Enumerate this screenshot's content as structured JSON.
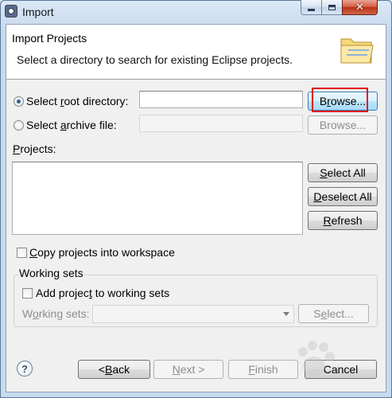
{
  "window": {
    "title": "Import",
    "close_glyph": "✕"
  },
  "banner": {
    "title": "Import Projects",
    "description": "Select a directory to search for existing Eclipse projects."
  },
  "source": {
    "root_directory": {
      "label_pre": "Select ",
      "label_u": "r",
      "label_post": "oot directory:",
      "selected": true,
      "value": "",
      "browse_pre": "B",
      "browse_u": "r",
      "browse_post": "owse..."
    },
    "archive_file": {
      "label_pre": "Select ",
      "label_u": "a",
      "label_post": "rchive file:",
      "selected": false,
      "value": "",
      "browse_label": "Browse..."
    }
  },
  "projects": {
    "label_u": "P",
    "label_post": "rojects:",
    "items": [],
    "select_all": {
      "u": "S",
      "rest": "elect All"
    },
    "deselect_all": {
      "u": "D",
      "rest": "eselect All"
    },
    "refresh": {
      "u": "R",
      "rest": "efresh"
    }
  },
  "options": {
    "copy_pre": "",
    "copy_u": "C",
    "copy_post": "opy projects into workspace",
    "copy_checked": false
  },
  "working_sets": {
    "legend": "Working sets",
    "add_pre": "Add projec",
    "add_u": "t",
    "add_post": " to working sets",
    "add_checked": false,
    "sets_pre": "W",
    "sets_u": "o",
    "sets_post": "rking sets:",
    "selected_value": "",
    "select_label_pre": "S",
    "select_label_u": "e",
    "select_label_post": "lect..."
  },
  "footer": {
    "help_glyph": "?",
    "back_pre": "< ",
    "back_u": "B",
    "back_post": "ack",
    "next_u": "N",
    "next_post": "ext >",
    "finish_u": "F",
    "finish_post": "inish",
    "cancel": "Cancel"
  },
  "colors": {
    "highlight_box": "#e0131b",
    "focus_button": "#3c7fb1"
  }
}
